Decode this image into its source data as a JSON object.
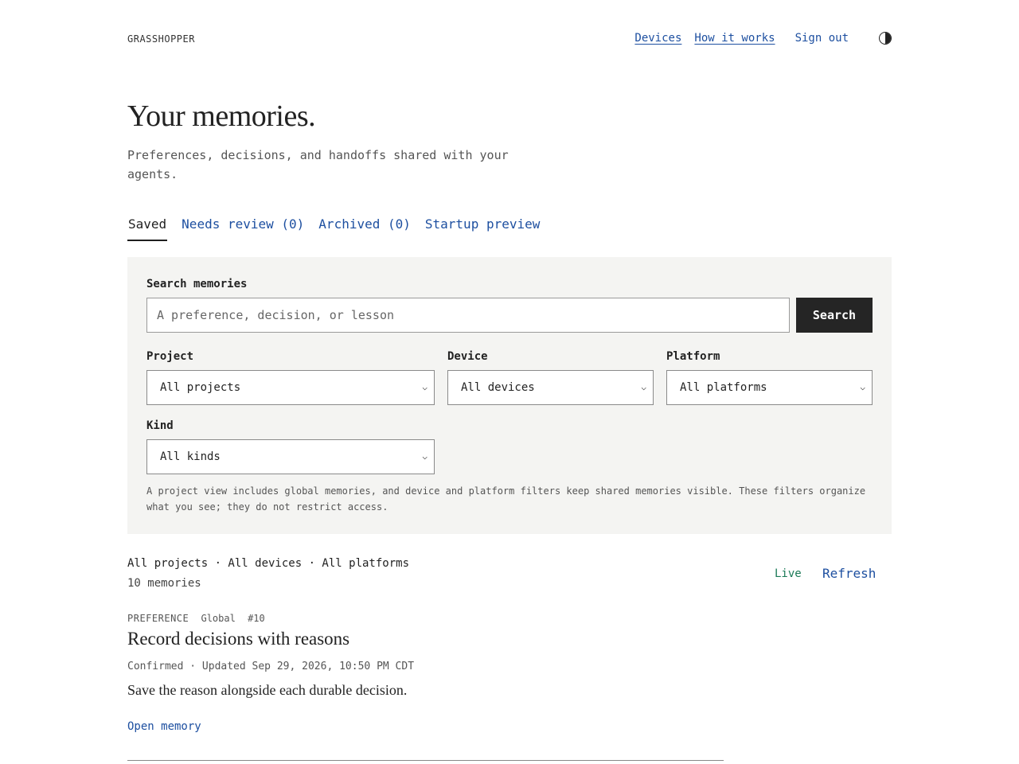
{
  "header": {
    "brand": "GRASSHOPPER",
    "nav": {
      "devices": "Devices",
      "how_it_works": "How it works",
      "sign_out": "Sign out"
    },
    "theme_toggle_icon": "half-circle-contrast-icon"
  },
  "hero": {
    "title": "Your memories.",
    "subtitle": "Preferences, decisions, and handoffs shared with your agents."
  },
  "tabs": [
    {
      "label": "Saved",
      "active": true
    },
    {
      "label": "Needs review (0)",
      "active": false
    },
    {
      "label": "Archived (0)",
      "active": false
    },
    {
      "label": "Startup preview",
      "active": false
    }
  ],
  "filters": {
    "search_label": "Search memories",
    "search_value": "",
    "search_placeholder": "A preference, decision, or lesson",
    "search_button": "Search",
    "project": {
      "label": "Project",
      "selected": "All projects"
    },
    "device": {
      "label": "Device",
      "selected": "All devices"
    },
    "platform": {
      "label": "Platform",
      "selected": "All platforms"
    },
    "kind": {
      "label": "Kind",
      "selected": "All kinds"
    },
    "note": "A project view includes global memories, and device and platform filters keep shared memories visible. These filters organize what you see; they do not restrict access."
  },
  "results": {
    "scope": "All projects · All devices · All platforms",
    "count": "10 memories",
    "live": "Live",
    "refresh": "Refresh"
  },
  "memory": {
    "kind": "PREFERENCE",
    "scope": "Global",
    "id": "#10",
    "title": "Record decisions with reasons",
    "status": "Confirmed · Updated Sep 29, 2026, 10:50 PM CDT",
    "body": "Save the reason alongside each durable decision.",
    "open_link": "Open memory"
  },
  "colors": {
    "link": "#1d4fa0",
    "live": "#1b7a57",
    "panel_bg": "#f4f4f2",
    "button_bg": "#252525"
  }
}
